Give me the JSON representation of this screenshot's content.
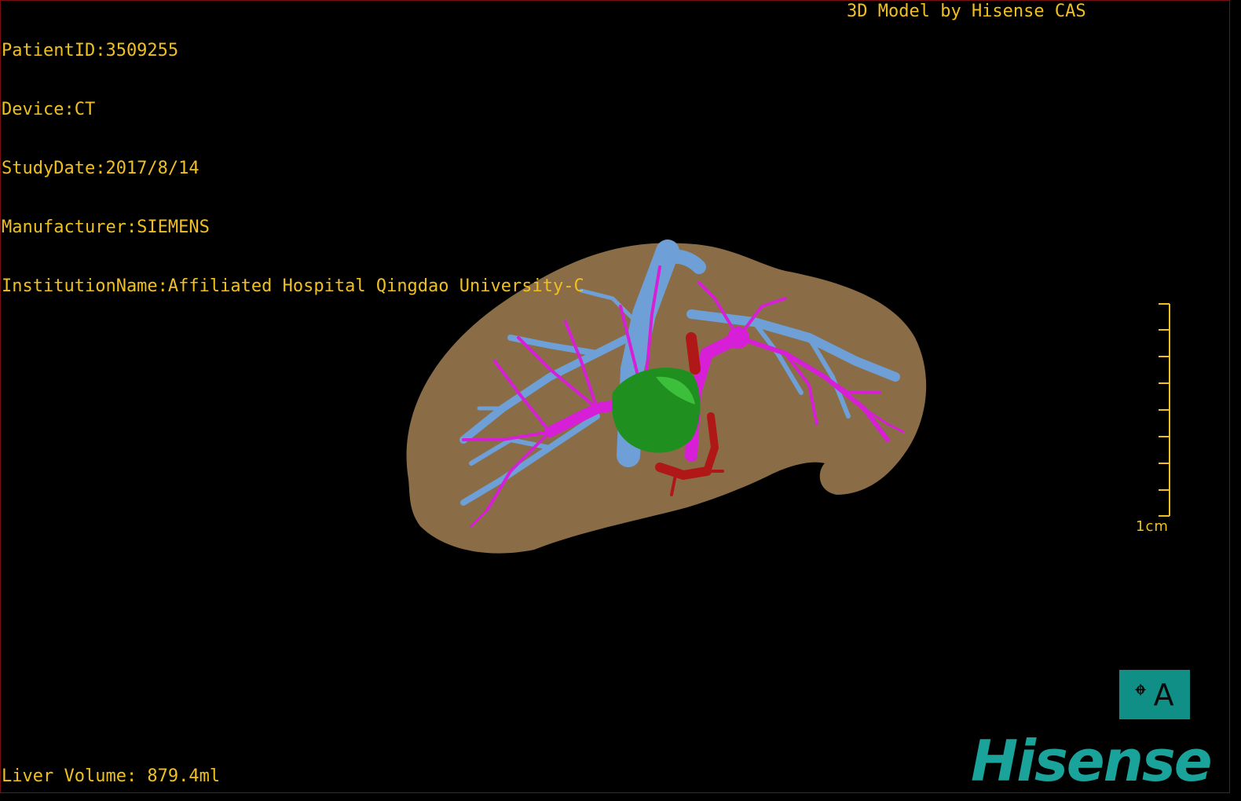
{
  "patient_info": {
    "patient_id": "PatientID:3509255",
    "device": "Device:CT",
    "study_date": "StudyDate:2017/8/14",
    "manufacturer": "Manufacturer:SIEMENS",
    "institution": "InstitutionName:Affiliated Hospital Qingdao University-C"
  },
  "brand_caption": "3D Model by Hisense CAS",
  "liver_volume": "Liver Volume: 879.4ml",
  "scale_bar": {
    "label": "1cm"
  },
  "orientation_button": {
    "left_glyph": "𝄌",
    "right_glyph": "A"
  },
  "logo_text": "Hisense",
  "colors": {
    "text": "#f0c020",
    "liver": "#8a6d46",
    "hepatic_vein": "#6e9fd6",
    "portal_vein": "#d61fd6",
    "artery": "#b01818",
    "tumor": "#1f8f1f",
    "brand": "#1aa39a"
  }
}
